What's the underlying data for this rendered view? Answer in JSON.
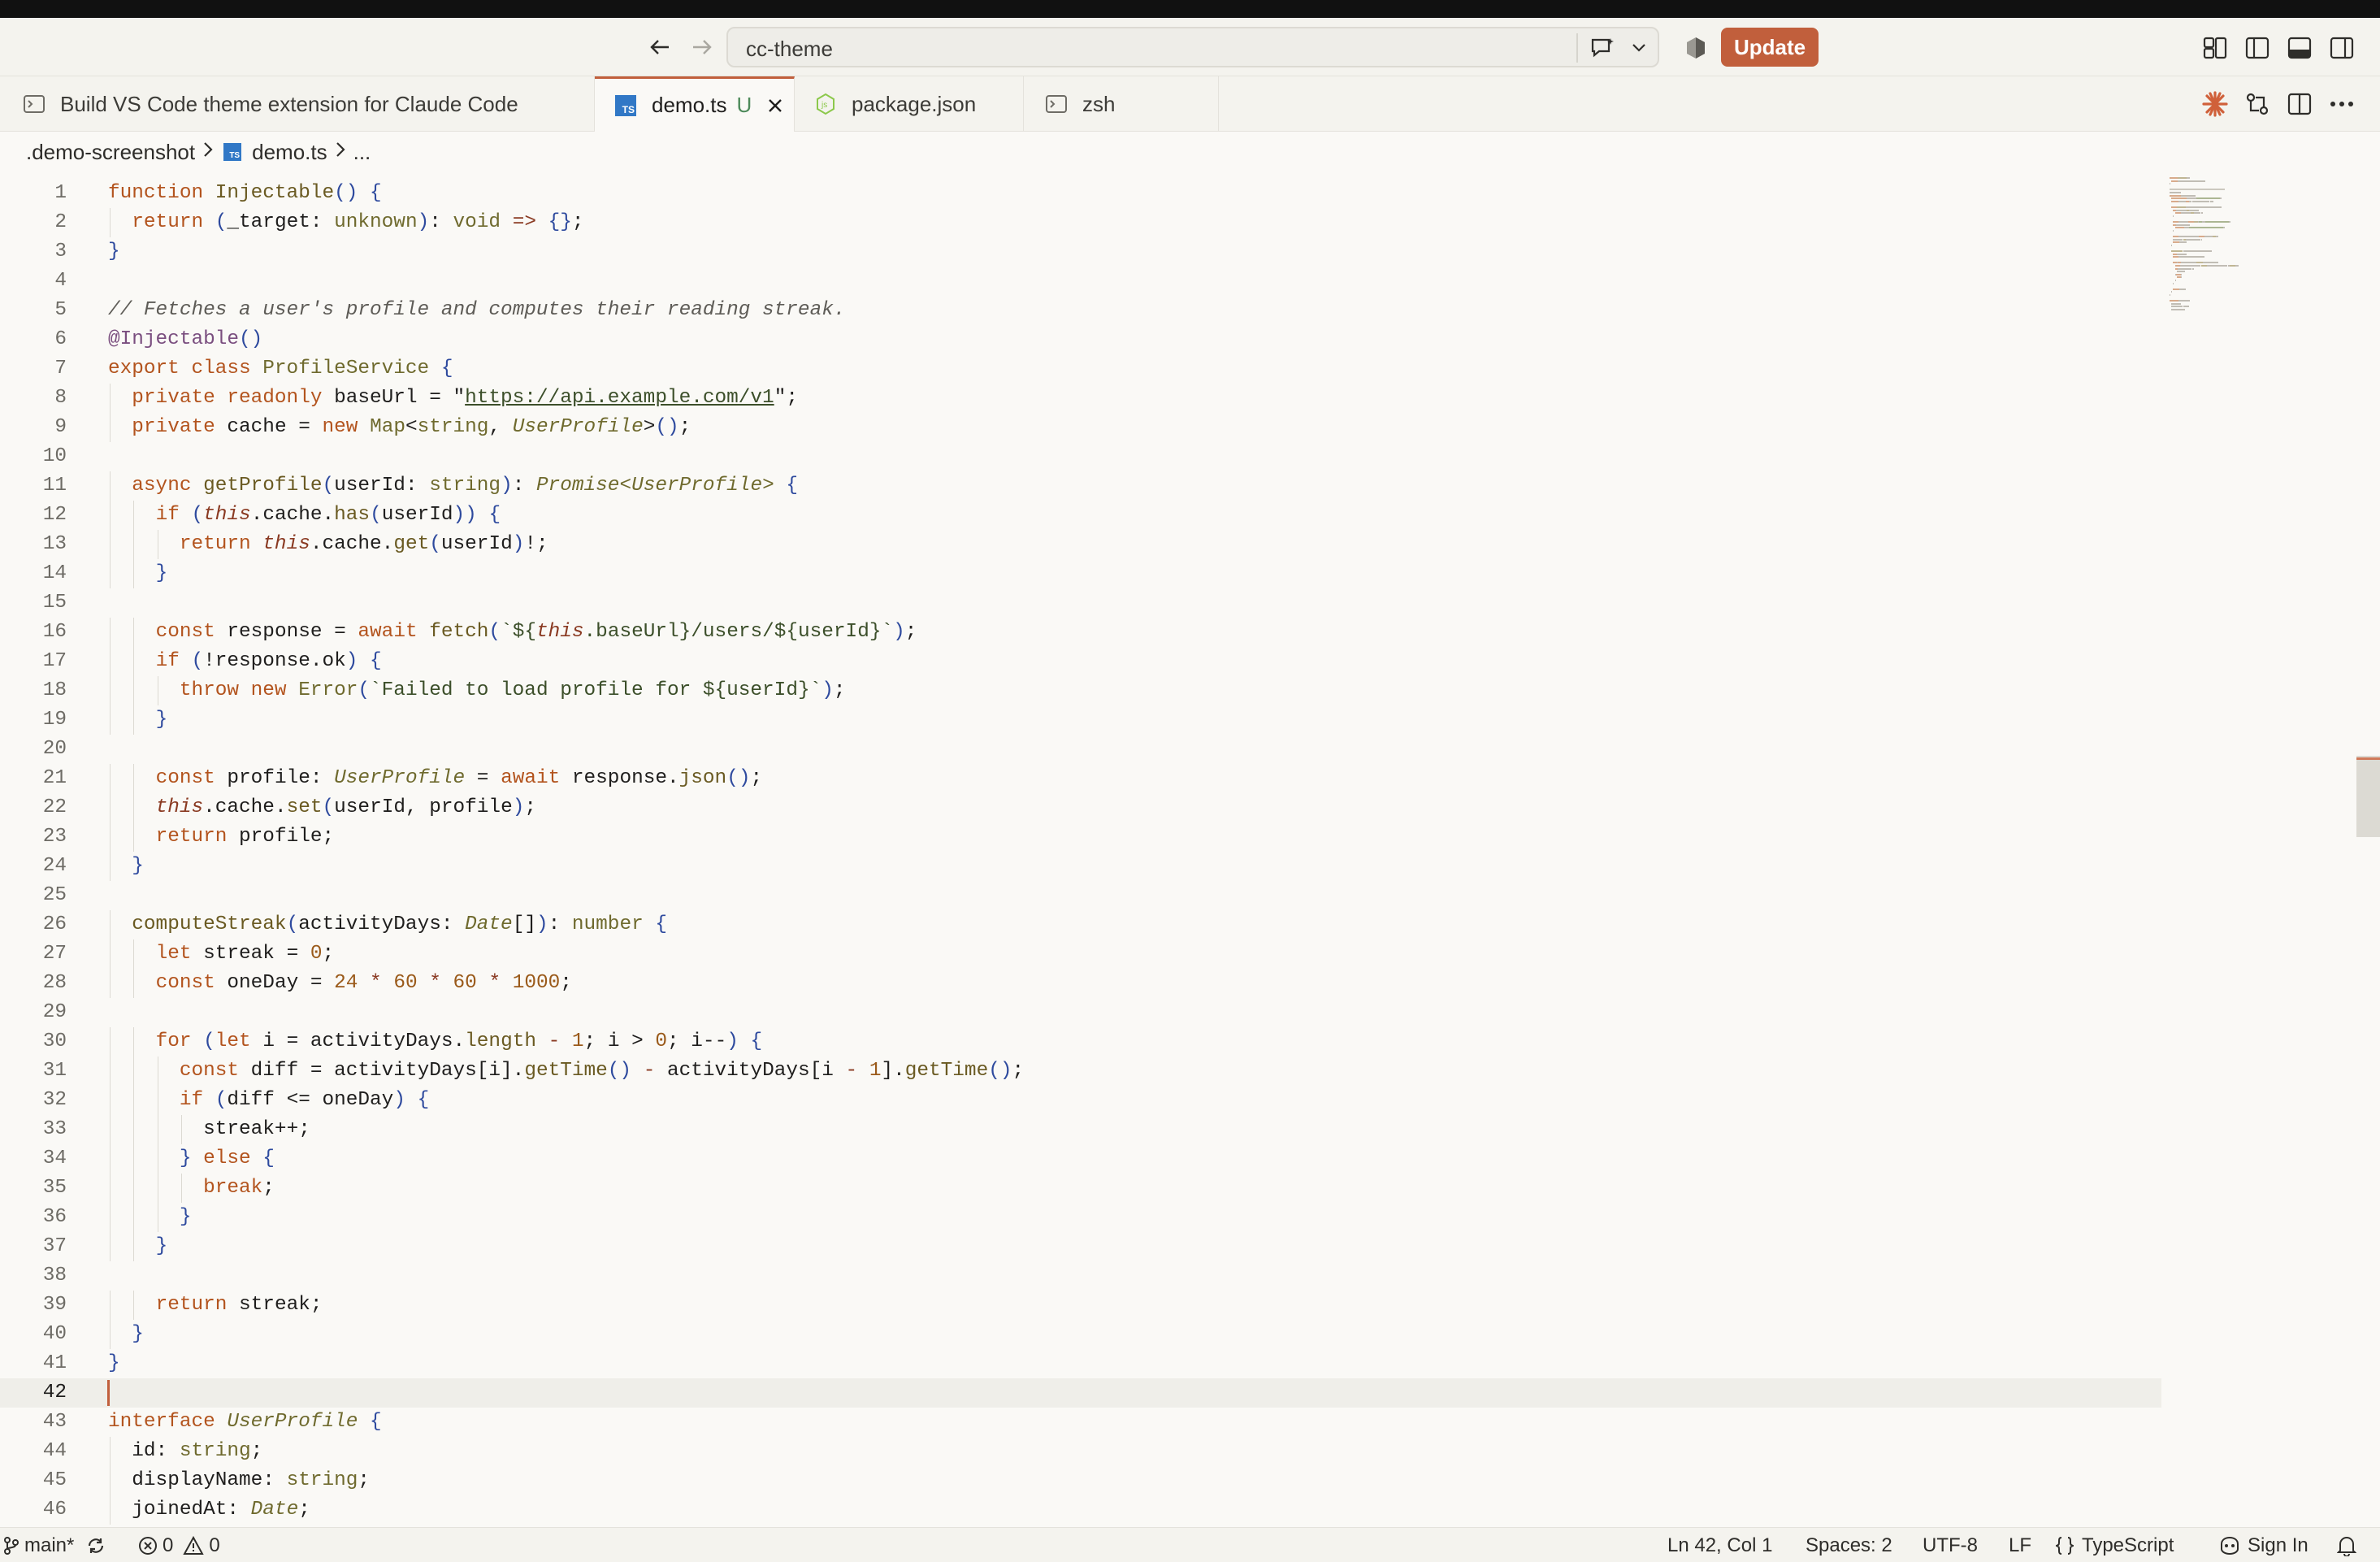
{
  "titlebar": {
    "command_center": "cc-theme",
    "update_label": "Update"
  },
  "tabs": [
    {
      "label": "Build VS Code theme extension for Claude Code",
      "icon": "terminal-icon"
    },
    {
      "label": "demo.ts",
      "status": "U",
      "icon": "typescript-icon"
    },
    {
      "label": "package.json",
      "icon": "nodejs-icon"
    },
    {
      "label": "zsh",
      "icon": "terminal-icon"
    }
  ],
  "breadcrumb": {
    "folder": ".demo-screenshot",
    "file": "demo.ts",
    "more": "..."
  },
  "editor": {
    "current_line": 42,
    "lines": [
      {
        "n": "1"
      },
      {
        "n": "2"
      },
      {
        "n": "3"
      },
      {
        "n": "4"
      },
      {
        "n": "5"
      },
      {
        "n": "6"
      },
      {
        "n": "7"
      },
      {
        "n": "8"
      },
      {
        "n": "9"
      },
      {
        "n": "10"
      },
      {
        "n": "11"
      },
      {
        "n": "12"
      },
      {
        "n": "13"
      },
      {
        "n": "14"
      },
      {
        "n": "15"
      },
      {
        "n": "16"
      },
      {
        "n": "17"
      },
      {
        "n": "18"
      },
      {
        "n": "19"
      },
      {
        "n": "20"
      },
      {
        "n": "21"
      },
      {
        "n": "22"
      },
      {
        "n": "23"
      },
      {
        "n": "24"
      },
      {
        "n": "25"
      },
      {
        "n": "26"
      },
      {
        "n": "27"
      },
      {
        "n": "28"
      },
      {
        "n": "29"
      },
      {
        "n": "30"
      },
      {
        "n": "31"
      },
      {
        "n": "32"
      },
      {
        "n": "33"
      },
      {
        "n": "34"
      },
      {
        "n": "35"
      },
      {
        "n": "36"
      },
      {
        "n": "37"
      },
      {
        "n": "38"
      },
      {
        "n": "39"
      },
      {
        "n": "40"
      },
      {
        "n": "41"
      },
      {
        "n": "42"
      },
      {
        "n": "43"
      },
      {
        "n": "44"
      },
      {
        "n": "45"
      },
      {
        "n": "46"
      }
    ],
    "code": [
      [
        [
          "kw",
          "function "
        ],
        [
          "fn",
          "Injectable"
        ],
        [
          "br",
          "() {"
        ]
      ],
      [
        [
          "",
          "  "
        ],
        [
          "kw",
          "return "
        ],
        [
          "br",
          "("
        ],
        [
          "",
          "_target: "
        ],
        [
          "ty",
          "unknown"
        ],
        [
          "br",
          ")"
        ],
        [
          "",
          ": "
        ],
        [
          "ty",
          "void "
        ],
        [
          "op",
          "=> "
        ],
        [
          "br",
          "{}"
        ],
        [
          "",
          ";"
        ]
      ],
      [
        [
          "br",
          "}"
        ]
      ],
      [],
      [
        [
          "cm",
          "// Fetches a user's profile and computes their reading streak."
        ]
      ],
      [
        [
          "dec",
          "@Injectable"
        ],
        [
          "br",
          "()"
        ]
      ],
      [
        [
          "kw",
          "export class "
        ],
        [
          "ty",
          "ProfileService "
        ],
        [
          "br",
          "{"
        ]
      ],
      [
        [
          "",
          "  "
        ],
        [
          "kw",
          "private readonly "
        ],
        [
          "",
          "baseUrl = \""
        ],
        [
          "url",
          "https://api.example.com/v1"
        ],
        [
          "",
          "\";"
        ]
      ],
      [
        [
          "",
          "  "
        ],
        [
          "kw",
          "private "
        ],
        [
          "",
          "cache = "
        ],
        [
          "kw",
          "new "
        ],
        [
          "ty",
          "Map"
        ],
        [
          "",
          "<"
        ],
        [
          "ty",
          "string"
        ],
        [
          "",
          ", "
        ],
        [
          "tyi",
          "UserProfile"
        ],
        [
          "",
          ">"
        ],
        [
          "br",
          "()"
        ],
        [
          "",
          ";"
        ]
      ],
      [],
      [
        [
          "",
          "  "
        ],
        [
          "kw",
          "async "
        ],
        [
          "fn",
          "getProfile"
        ],
        [
          "br",
          "("
        ],
        [
          "",
          "userId: "
        ],
        [
          "ty",
          "string"
        ],
        [
          "br",
          ")"
        ],
        [
          "",
          ": "
        ],
        [
          "tyi",
          "Promise<UserProfile> "
        ],
        [
          "br",
          "{"
        ]
      ],
      [
        [
          "",
          "    "
        ],
        [
          "kw",
          "if "
        ],
        [
          "br",
          "("
        ],
        [
          "th",
          "this"
        ],
        [
          "",
          ".cache."
        ],
        [
          "fn",
          "has"
        ],
        [
          "br",
          "("
        ],
        [
          "",
          "userId"
        ],
        [
          "br",
          "))"
        ],
        [
          "br",
          " {"
        ]
      ],
      [
        [
          "",
          "      "
        ],
        [
          "kw",
          "return "
        ],
        [
          "th",
          "this"
        ],
        [
          "",
          ".cache."
        ],
        [
          "fn",
          "get"
        ],
        [
          "br",
          "("
        ],
        [
          "",
          "userId"
        ],
        [
          "br",
          ")"
        ],
        [
          "",
          "!;"
        ]
      ],
      [
        [
          "",
          "    "
        ],
        [
          "br",
          "}"
        ]
      ],
      [],
      [
        [
          "",
          "    "
        ],
        [
          "kw",
          "const "
        ],
        [
          "",
          "response = "
        ],
        [
          "kw",
          "await "
        ],
        [
          "fn",
          "fetch"
        ],
        [
          "br",
          "("
        ],
        [
          "str",
          "`${"
        ],
        [
          "th",
          "this"
        ],
        [
          "str",
          ".baseUrl}/users/${userId}`"
        ],
        [
          "br",
          ")"
        ],
        [
          "",
          ";"
        ]
      ],
      [
        [
          "",
          "    "
        ],
        [
          "kw",
          "if "
        ],
        [
          "br",
          "("
        ],
        [
          "",
          "!response.ok"
        ],
        [
          "br",
          ")"
        ],
        [
          "br",
          " {"
        ]
      ],
      [
        [
          "",
          "      "
        ],
        [
          "kw",
          "throw new "
        ],
        [
          "ty",
          "Error"
        ],
        [
          "br",
          "("
        ],
        [
          "str",
          "`Failed to load profile for ${userId}`"
        ],
        [
          "br",
          ")"
        ],
        [
          "",
          ";"
        ]
      ],
      [
        [
          "",
          "    "
        ],
        [
          "br",
          "}"
        ]
      ],
      [],
      [
        [
          "",
          "    "
        ],
        [
          "kw",
          "const "
        ],
        [
          "",
          "profile: "
        ],
        [
          "tyi",
          "UserProfile "
        ],
        [
          "",
          "= "
        ],
        [
          "kw",
          "await "
        ],
        [
          "",
          "response."
        ],
        [
          "fn",
          "json"
        ],
        [
          "br",
          "()"
        ],
        [
          "",
          ";"
        ]
      ],
      [
        [
          "",
          "    "
        ],
        [
          "th",
          "this"
        ],
        [
          "",
          ".cache."
        ],
        [
          "fn",
          "set"
        ],
        [
          "br",
          "("
        ],
        [
          "",
          "userId, profile"
        ],
        [
          "br",
          ")"
        ],
        [
          "",
          ";"
        ]
      ],
      [
        [
          "",
          "    "
        ],
        [
          "kw",
          "return "
        ],
        [
          "",
          "profile;"
        ]
      ],
      [
        [
          "",
          "  "
        ],
        [
          "br",
          "}"
        ]
      ],
      [],
      [
        [
          "",
          "  "
        ],
        [
          "fn",
          "computeStreak"
        ],
        [
          "br",
          "("
        ],
        [
          "",
          "activityDays: "
        ],
        [
          "tyi",
          "Date"
        ],
        [
          "",
          "[]"
        ],
        [
          "br",
          ")"
        ],
        [
          "",
          ": "
        ],
        [
          "ty",
          "number "
        ],
        [
          "br",
          "{"
        ]
      ],
      [
        [
          "",
          "    "
        ],
        [
          "kw",
          "let "
        ],
        [
          "",
          "streak = "
        ],
        [
          "num",
          "0"
        ],
        [
          "",
          ";"
        ]
      ],
      [
        [
          "",
          "    "
        ],
        [
          "kw",
          "const "
        ],
        [
          "",
          "oneDay = "
        ],
        [
          "num",
          "24 "
        ],
        [
          "op",
          "* "
        ],
        [
          "num",
          "60 "
        ],
        [
          "op",
          "* "
        ],
        [
          "num",
          "60 "
        ],
        [
          "op",
          "* "
        ],
        [
          "num",
          "1000"
        ],
        [
          "",
          ";"
        ]
      ],
      [],
      [
        [
          "",
          "    "
        ],
        [
          "kw",
          "for "
        ],
        [
          "br",
          "("
        ],
        [
          "kw",
          "let "
        ],
        [
          "",
          "i = activityDays."
        ],
        [
          "fn",
          "length "
        ],
        [
          "op",
          "- "
        ],
        [
          "num",
          "1"
        ],
        [
          "",
          "; i > "
        ],
        [
          "num",
          "0"
        ],
        [
          "",
          "; i--"
        ],
        [
          "br",
          ")"
        ],
        [
          "br",
          " {"
        ]
      ],
      [
        [
          "",
          "      "
        ],
        [
          "kw",
          "const "
        ],
        [
          "",
          "diff = activityDays[i]."
        ],
        [
          "fn",
          "getTime"
        ],
        [
          "br",
          "()"
        ],
        [
          "op",
          " - "
        ],
        [
          "",
          "activityDays[i "
        ],
        [
          "op",
          "- "
        ],
        [
          "num",
          "1"
        ],
        [
          "",
          "]."
        ],
        [
          "fn",
          "getTime"
        ],
        [
          "br",
          "()"
        ],
        [
          "",
          ";"
        ]
      ],
      [
        [
          "",
          "      "
        ],
        [
          "kw",
          "if "
        ],
        [
          "br",
          "("
        ],
        [
          "",
          "diff <= oneDay"
        ],
        [
          "br",
          ")"
        ],
        [
          "br",
          " {"
        ]
      ],
      [
        [
          "",
          "        "
        ],
        [
          "",
          "streak++;"
        ]
      ],
      [
        [
          "",
          "      "
        ],
        [
          "br",
          "}"
        ],
        [
          "kw",
          " else "
        ],
        [
          "br",
          "{"
        ]
      ],
      [
        [
          "",
          "        "
        ],
        [
          "kw",
          "break"
        ],
        [
          "",
          ";"
        ]
      ],
      [
        [
          "",
          "      "
        ],
        [
          "br",
          "}"
        ]
      ],
      [
        [
          "",
          "    "
        ],
        [
          "br",
          "}"
        ]
      ],
      [],
      [
        [
          "",
          "    "
        ],
        [
          "kw",
          "return "
        ],
        [
          "",
          "streak;"
        ]
      ],
      [
        [
          "",
          "  "
        ],
        [
          "br",
          "}"
        ]
      ],
      [
        [
          "br",
          "}"
        ]
      ],
      [],
      [
        [
          "kw",
          "interface "
        ],
        [
          "tyi",
          "UserProfile "
        ],
        [
          "br",
          "{"
        ]
      ],
      [
        [
          "",
          "  "
        ],
        [
          "",
          "id: "
        ],
        [
          "ty",
          "string"
        ],
        [
          "",
          ";"
        ]
      ],
      [
        [
          "",
          "  "
        ],
        [
          "",
          "displayName: "
        ],
        [
          "ty",
          "string"
        ],
        [
          "",
          ";"
        ]
      ],
      [
        [
          "",
          "  "
        ],
        [
          "",
          "joinedAt: "
        ],
        [
          "tyi",
          "Date"
        ],
        [
          "",
          ";"
        ]
      ]
    ]
  },
  "statusbar": {
    "branch": "main*",
    "errors": "0",
    "warnings": "0",
    "position": "Ln 42, Col 1",
    "spaces": "Spaces: 2",
    "encoding": "UTF-8",
    "eol": "LF",
    "language": "TypeScript",
    "sign_in": "Sign In"
  },
  "colors": {
    "accent": "#c15f3c",
    "keyword": "#b3541e",
    "background": "#faf9f6"
  }
}
